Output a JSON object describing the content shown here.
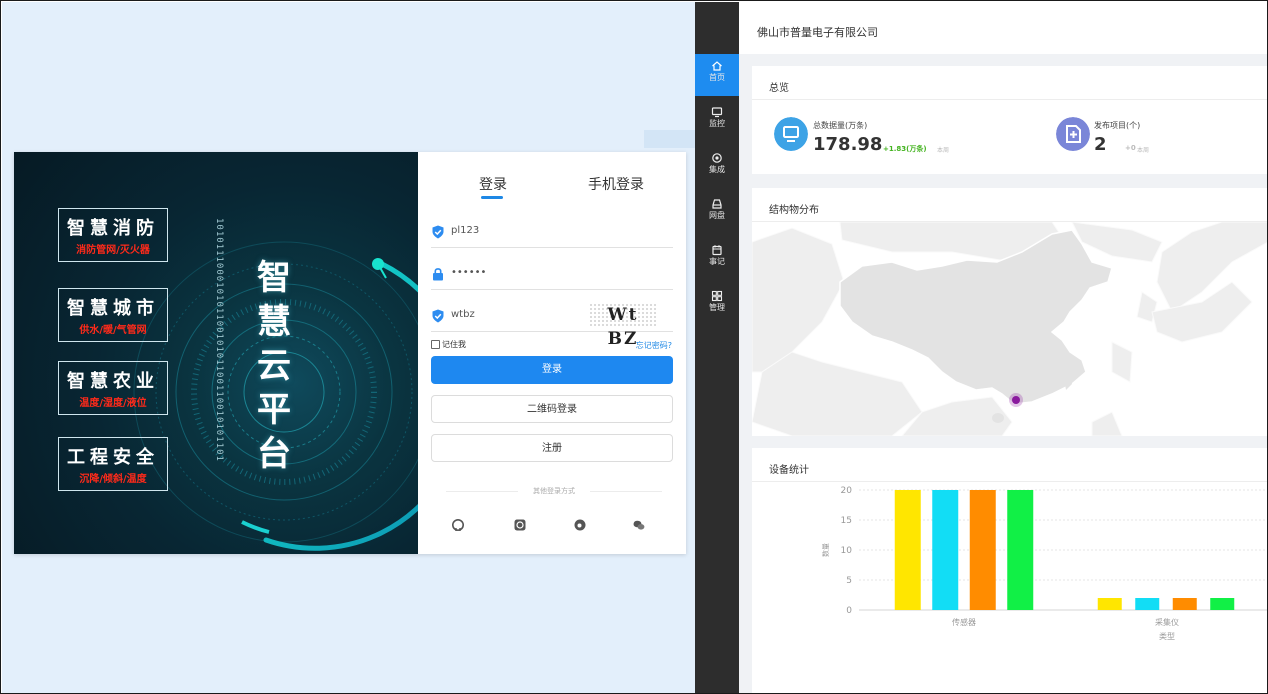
{
  "login": {
    "features": [
      {
        "title": "智慧消防",
        "subtitle": "消防管网/灭火器"
      },
      {
        "title": "智慧城市",
        "subtitle": "供水/暖/气管网"
      },
      {
        "title": "智慧农业",
        "subtitle": "温度/湿度/液位"
      },
      {
        "title": "工程安全",
        "subtitle": "沉降/倾斜/温度"
      }
    ],
    "binary": "10101110001010110010101100110010101101",
    "vertical_title": [
      "智",
      "慧",
      "云",
      "平",
      "台"
    ],
    "tabs": {
      "login": "登录",
      "phone": "手机登录"
    },
    "username": "pl123",
    "password": "••••••",
    "captcha_input": "wtbz",
    "captcha_image_text": "Wt BZ",
    "remember_label": "记住我",
    "forgot_label": "忘记密码?",
    "login_button": "登录",
    "qr_button": "二维码登录",
    "register_button": "注册",
    "other_methods_label": "其他登录方式",
    "social_icons": [
      "github-icon",
      "qq-icon",
      "weibo-icon",
      "wechat-icon"
    ],
    "accent_color": "#1e88f0"
  },
  "dashboard": {
    "company": "佛山市普量电子有限公司",
    "nav": [
      {
        "label": "首页",
        "icon": "home-icon",
        "active": true
      },
      {
        "label": "监控",
        "icon": "monitor-icon",
        "active": false
      },
      {
        "label": "集成",
        "icon": "integration-icon",
        "active": false
      },
      {
        "label": "网盘",
        "icon": "disk-icon",
        "active": false
      },
      {
        "label": "事记",
        "icon": "calendar-icon",
        "active": false
      },
      {
        "label": "管理",
        "icon": "grid-icon",
        "active": false
      }
    ],
    "overview": {
      "title": "总览",
      "stats": [
        {
          "label": "总数据量(万条)",
          "value": "178.98",
          "delta": "+1.83(万条)",
          "period": "本周",
          "icon": "monitor-icon",
          "color": "#3da3e6"
        },
        {
          "label": "发布项目(个)",
          "value": "2",
          "delta": "+0",
          "period": "本周",
          "icon": "add-file-icon",
          "color": "#7a86d8"
        }
      ]
    },
    "map": {
      "title": "结构物分布",
      "marker_color": "#8a1a9e"
    },
    "device_stats": {
      "title": "设备统计"
    }
  },
  "chart_data": {
    "type": "bar",
    "title": "设备统计",
    "categories": [
      "传感器",
      "采集仪"
    ],
    "xlabel": "类型",
    "ylabel": "数量",
    "ylim": [
      0,
      20
    ],
    "yticks": [
      0,
      5,
      10,
      15,
      20
    ],
    "grid": "dashed horizontal",
    "series": [
      {
        "values": [
          20,
          2
        ],
        "color": "#ffe600"
      },
      {
        "values": [
          20,
          2
        ],
        "color": "#12ddf5"
      },
      {
        "values": [
          20,
          2
        ],
        "color": "#ff8c00"
      },
      {
        "values": [
          20,
          2
        ],
        "color": "#11f046"
      }
    ]
  }
}
